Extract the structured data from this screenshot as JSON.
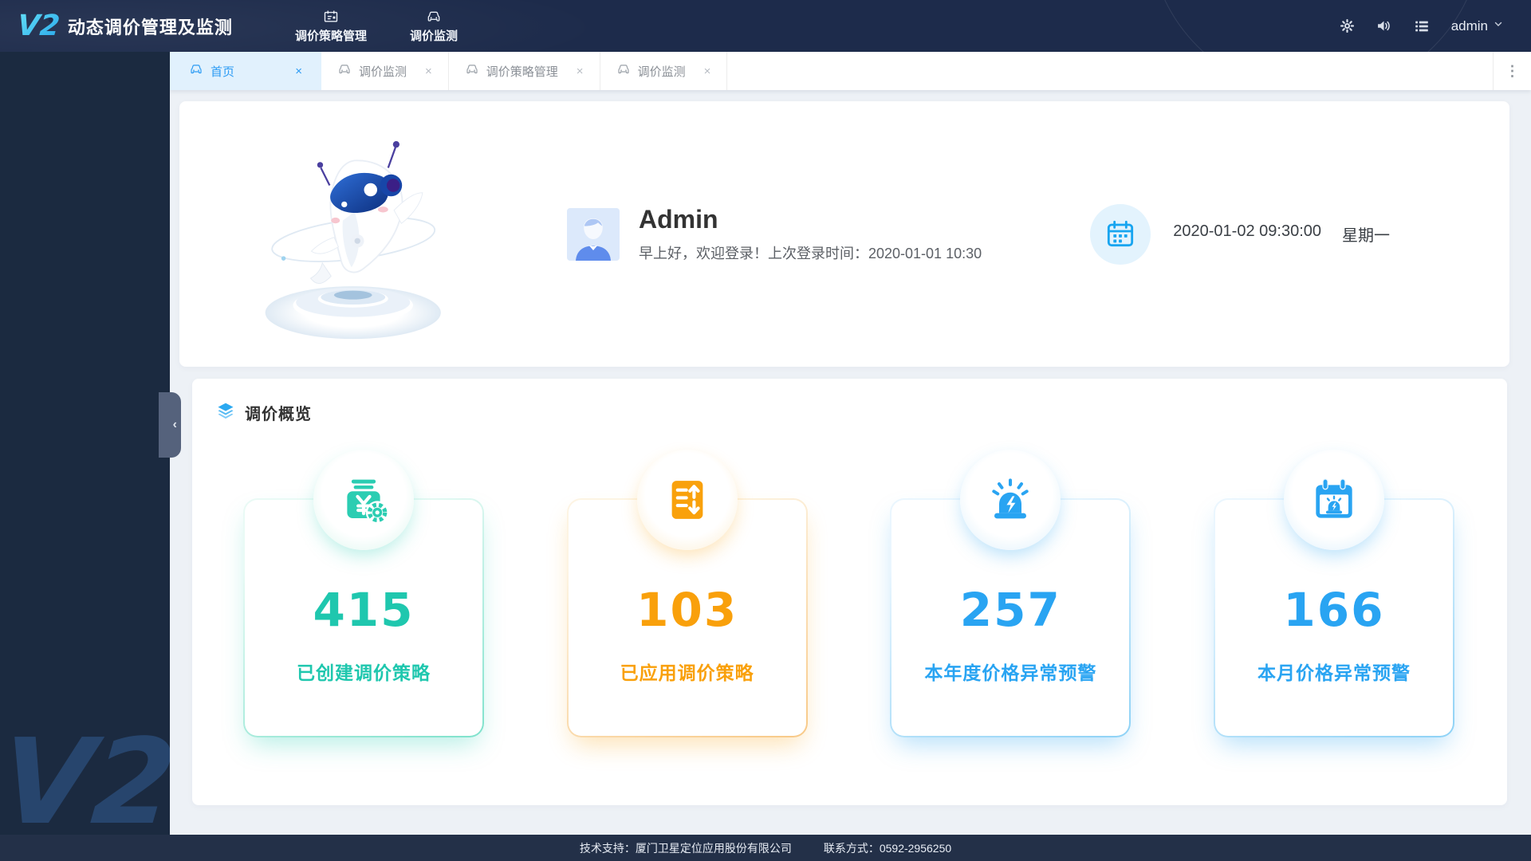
{
  "app": {
    "logo": "V2",
    "title": "动态调价管理及监测"
  },
  "header": {
    "nav": [
      {
        "label": "调价策略管理",
        "icon": "strategy-card-icon"
      },
      {
        "label": "调价监测",
        "icon": "car-icon"
      }
    ],
    "icons": {
      "settings": "gear-icon",
      "sound": "speaker-icon",
      "menu": "list-icon"
    },
    "user": "admin"
  },
  "sidebar": {
    "collapse_glyph": "‹"
  },
  "tabs": {
    "close_glyph": "×",
    "overflow_glyph": "⋮",
    "items": [
      {
        "label": "首页",
        "active": true
      },
      {
        "label": "调价监测",
        "active": false
      },
      {
        "label": "调价策略管理",
        "active": false
      },
      {
        "label": "调价监测",
        "active": false
      }
    ]
  },
  "welcome": {
    "name": "Admin",
    "greeting": "早上好，欢迎登录！上次登录时间：2020-01-01 10:30",
    "datetime": "2020-01-02 09:30:00",
    "weekday": "星期一"
  },
  "overview": {
    "title": "调价概览",
    "stats": [
      {
        "value": "415",
        "label": "已创建调价策略",
        "color": "#1fc7ae",
        "icon": "price-strategy-gear-icon"
      },
      {
        "value": "103",
        "label": "已应用调价策略",
        "color": "#f9a00b",
        "icon": "applied-strategy-doc-icon"
      },
      {
        "value": "257",
        "label": "本年度价格异常预警",
        "color": "#29a4f2",
        "icon": "alarm-siren-icon"
      },
      {
        "value": "166",
        "label": "本月价格异常预警",
        "color": "#29a4f2",
        "icon": "calendar-alarm-icon"
      }
    ]
  },
  "footer": {
    "support": "技术支持：厦门卫星定位应用股份有限公司",
    "contact": "联系方式：0592-2956250"
  },
  "colors": {
    "header_bg": "#1d2b4b",
    "active_tab_bg": "#e1f1fd",
    "accent_blue": "#2b9bf4"
  }
}
